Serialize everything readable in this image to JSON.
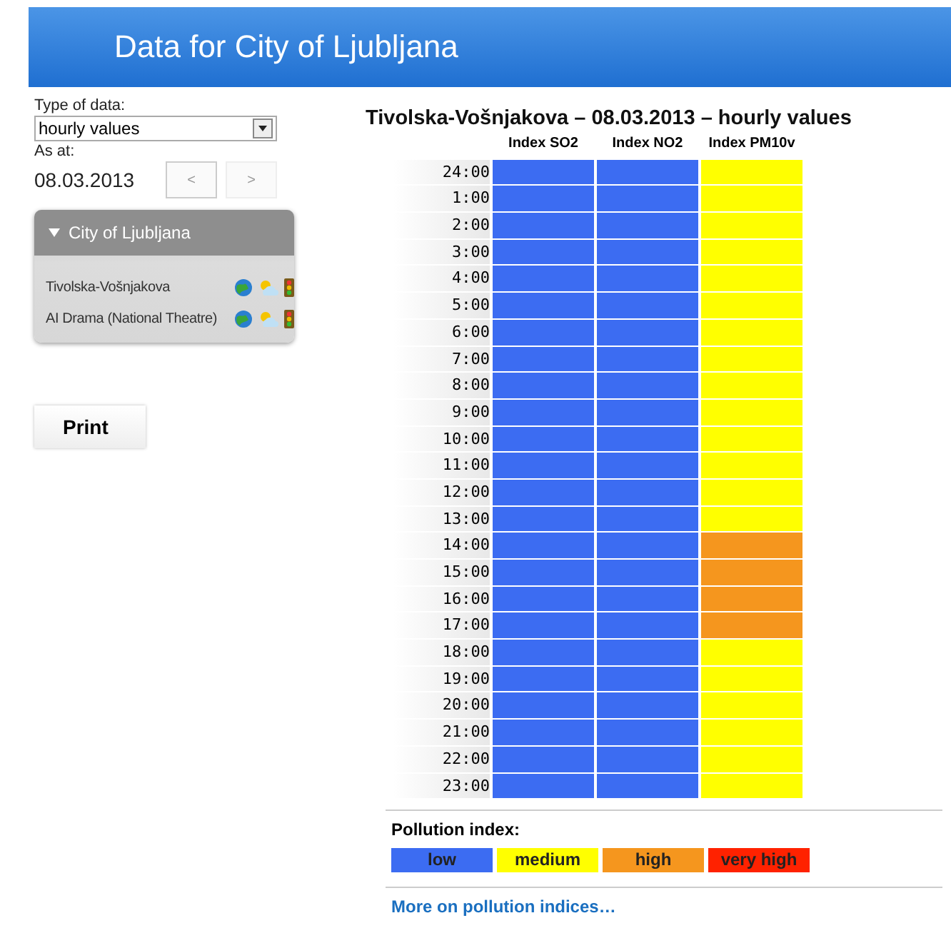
{
  "header": {
    "title": "Data for City of Ljubljana"
  },
  "controls": {
    "type_label": "Type of data:",
    "type_value": "hourly values",
    "date_label": "As at:",
    "date_value": "08.03.2013",
    "prev": "<",
    "next": ">"
  },
  "stations_panel": {
    "title": "City of Ljubljana",
    "expanded": true,
    "stations": [
      {
        "name": "Tivolska-Vošnjakova"
      },
      {
        "name": "AI Drama (National Theatre)"
      }
    ]
  },
  "print_button": "Print",
  "table": {
    "title": "Tivolska-Vošnjakova – 08.03.2013 – hourly values",
    "columns": [
      "Index SO2",
      "Index NO2",
      "Index PM10v"
    ],
    "rows": [
      {
        "time": "24:00",
        "cells": [
          {
            "color": "#3c6cf2"
          },
          {
            "color": "#3c6cf2"
          },
          {
            "color": "#ffff00"
          }
        ]
      },
      {
        "time": "1:00",
        "cells": [
          {
            "color": "#3c6cf2"
          },
          {
            "color": "#3c6cf2"
          },
          {
            "color": "#ffff00"
          }
        ]
      },
      {
        "time": "2:00",
        "cells": [
          {
            "color": "#3c6cf2"
          },
          {
            "color": "#3c6cf2"
          },
          {
            "color": "#ffff00"
          }
        ]
      },
      {
        "time": "3:00",
        "cells": [
          {
            "color": "#3c6cf2"
          },
          {
            "color": "#3c6cf2"
          },
          {
            "color": "#ffff00"
          }
        ]
      },
      {
        "time": "4:00",
        "cells": [
          {
            "color": "#3c6cf2"
          },
          {
            "color": "#3c6cf2"
          },
          {
            "color": "#ffff00"
          }
        ]
      },
      {
        "time": "5:00",
        "cells": [
          {
            "color": "#3c6cf2"
          },
          {
            "color": "#3c6cf2"
          },
          {
            "color": "#ffff00"
          }
        ]
      },
      {
        "time": "6:00",
        "cells": [
          {
            "color": "#3c6cf2"
          },
          {
            "color": "#3c6cf2"
          },
          {
            "color": "#ffff00"
          }
        ]
      },
      {
        "time": "7:00",
        "cells": [
          {
            "color": "#3c6cf2"
          },
          {
            "color": "#3c6cf2"
          },
          {
            "color": "#ffff00"
          }
        ]
      },
      {
        "time": "8:00",
        "cells": [
          {
            "color": "#3c6cf2"
          },
          {
            "color": "#3c6cf2"
          },
          {
            "color": "#ffff00"
          }
        ]
      },
      {
        "time": "9:00",
        "cells": [
          {
            "color": "#3c6cf2"
          },
          {
            "color": "#3c6cf2"
          },
          {
            "color": "#ffff00"
          }
        ]
      },
      {
        "time": "10:00",
        "cells": [
          {
            "color": "#3c6cf2"
          },
          {
            "color": "#3c6cf2"
          },
          {
            "color": "#ffff00"
          }
        ]
      },
      {
        "time": "11:00",
        "cells": [
          {
            "color": "#3c6cf2"
          },
          {
            "color": "#3c6cf2"
          },
          {
            "color": "#ffff00"
          }
        ]
      },
      {
        "time": "12:00",
        "cells": [
          {
            "color": "#3c6cf2"
          },
          {
            "color": "#3c6cf2"
          },
          {
            "color": "#ffff00"
          }
        ]
      },
      {
        "time": "13:00",
        "cells": [
          {
            "color": "#3c6cf2"
          },
          {
            "color": "#3c6cf2"
          },
          {
            "color": "#ffff00"
          }
        ]
      },
      {
        "time": "14:00",
        "cells": [
          {
            "color": "#3c6cf2"
          },
          {
            "color": "#3c6cf2"
          },
          {
            "color": "#f5961e"
          }
        ]
      },
      {
        "time": "15:00",
        "cells": [
          {
            "color": "#3c6cf2"
          },
          {
            "color": "#3c6cf2"
          },
          {
            "color": "#f5961e"
          }
        ]
      },
      {
        "time": "16:00",
        "cells": [
          {
            "color": "#3c6cf2"
          },
          {
            "color": "#3c6cf2"
          },
          {
            "color": "#f5961e"
          }
        ]
      },
      {
        "time": "17:00",
        "cells": [
          {
            "color": "#3c6cf2"
          },
          {
            "color": "#3c6cf2"
          },
          {
            "color": "#f5961e"
          }
        ]
      },
      {
        "time": "18:00",
        "cells": [
          {
            "color": "#3c6cf2"
          },
          {
            "color": "#3c6cf2"
          },
          {
            "color": "#ffff00"
          }
        ]
      },
      {
        "time": "19:00",
        "cells": [
          {
            "color": "#3c6cf2"
          },
          {
            "color": "#3c6cf2"
          },
          {
            "color": "#ffff00"
          }
        ]
      },
      {
        "time": "20:00",
        "cells": [
          {
            "color": "#3c6cf2"
          },
          {
            "color": "#3c6cf2"
          },
          {
            "color": "#ffff00"
          }
        ]
      },
      {
        "time": "21:00",
        "cells": [
          {
            "color": "#3c6cf2"
          },
          {
            "color": "#3c6cf2"
          },
          {
            "color": "#ffff00"
          }
        ]
      },
      {
        "time": "22:00",
        "cells": [
          {
            "color": "#3c6cf2"
          },
          {
            "color": "#3c6cf2"
          },
          {
            "color": "#ffff00"
          }
        ]
      },
      {
        "time": "23:00",
        "cells": [
          {
            "color": "#3c6cf2"
          },
          {
            "color": "#3c6cf2"
          },
          {
            "color": "#ffff00"
          }
        ]
      }
    ]
  },
  "legend": {
    "title": "Pollution index:",
    "items": [
      {
        "label": "low",
        "color": "#3c6cf2"
      },
      {
        "label": "medium",
        "color": "#ffff00"
      },
      {
        "label": "high",
        "color": "#f5961e"
      },
      {
        "label": "very high",
        "color": "#ff2200"
      }
    ],
    "link": "More on pollution indices…"
  }
}
